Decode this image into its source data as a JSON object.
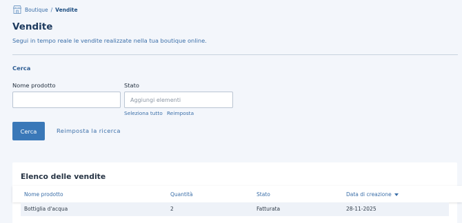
{
  "breadcrumb": {
    "icon": "shop-icon",
    "items": [
      "Boutique",
      "Vendite"
    ],
    "separator": "/"
  },
  "page": {
    "title": "Vendite",
    "subtitle": "Segui in tempo reale le vendite realizzate nella tua boutique online."
  },
  "search": {
    "heading": "Cerca",
    "product_name_label": "Nome prodotto",
    "product_name_value": "",
    "status_label": "Stato",
    "status_placeholder": "Aggiungi elementi",
    "select_all": "Seleziona tutto",
    "reset_status": "Reimposta",
    "search_button": "Cerca",
    "reset_search": "Reimposta la ricerca"
  },
  "sales": {
    "title": "Elenco delle vendite",
    "columns": [
      "Nome prodotto",
      "Quantità",
      "Stato",
      "Data di creazione"
    ],
    "sort_icon": "caret-down-icon",
    "rows": [
      [
        "Bottiglia d'acqua",
        "2",
        "Fatturata",
        "28-11-2025"
      ]
    ]
  },
  "colors": {
    "accent": "#3a78b8",
    "link": "#3a6ea8",
    "background": "#f3f6fb"
  }
}
